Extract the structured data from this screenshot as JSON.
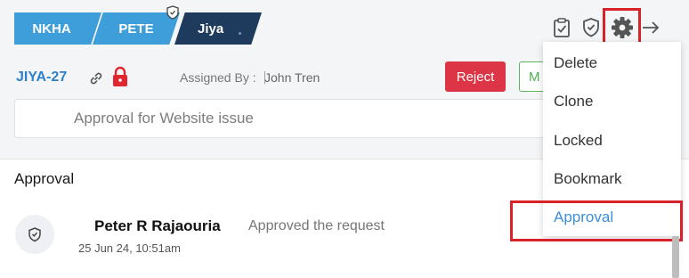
{
  "tags": {
    "nkha": "NKHA",
    "pete": "PETE",
    "jiya": "Jiya"
  },
  "issue": {
    "id": "JIYA-27",
    "assigned_label": "Assigned By :",
    "assigned_name": "John Tren"
  },
  "actions": {
    "reject_label": "Reject",
    "second_button_label": "M"
  },
  "description": {
    "placeholder": "Approval for Website issue"
  },
  "toolbar_icons": [
    "clipboard-check-icon",
    "shield-check-icon",
    "gear-icon",
    "arrow-right-icon"
  ],
  "menu": {
    "items": [
      "Delete",
      "Clone",
      "Locked",
      "Bookmark",
      "Approval"
    ],
    "active": "Approval"
  },
  "approval_section": {
    "title": "Approval",
    "entry": {
      "name": "Peter R Rajaouria",
      "action": "Approved the request",
      "timestamp": "25 Jun 24, 10:51am"
    }
  },
  "colors": {
    "tag_blue": "#3e9ed9",
    "tag_dark": "#1e3a5c",
    "link_blue": "#2f80c7",
    "reject_red": "#dc3545",
    "accent_green": "#5cb85c",
    "highlight_red": "#d8222a",
    "menu_active": "#3d8fd6"
  }
}
